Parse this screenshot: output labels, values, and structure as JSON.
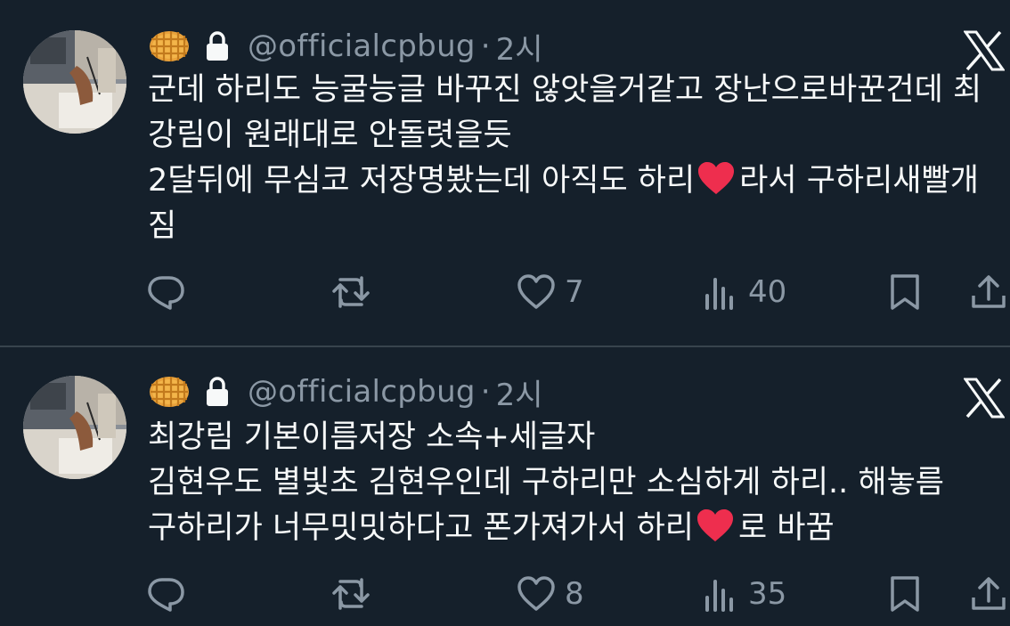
{
  "tweets": [
    {
      "handle": "@officialcpbug",
      "separator": "·",
      "time": "2시",
      "lines": [
        "군데 하리도 능굴능글 바꾸진 않앗을거같고 장난으로바꾼건데 최",
        "강림이 원래대로 안돌렷을듯",
        {
          "before": "2달뒤에 무심코 저장명봤는데 아직도 하리",
          "after": "라서 구하리새빨개"
        },
        "짐"
      ],
      "likes": "7",
      "views": "40"
    },
    {
      "handle": "@officialcpbug",
      "separator": "·",
      "time": "2시",
      "lines": [
        "최강림 기본이름저장 소속+세글자",
        "김현우도 별빛초 김현우인데 구하리만 소심하게 하리.. 해놓름",
        {
          "before": "구하리가 너무밋밋하다고 폰가져가서 하리",
          "after": "로 바꿈"
        }
      ],
      "likes": "8",
      "views": "35"
    }
  ],
  "icons": {
    "emoji_name": "waffle-icon",
    "lock": "lock-icon",
    "brand": "x-logo-icon",
    "heart_emoji": "red-heart-icon",
    "reply": "reply-icon",
    "retweet": "retweet-icon",
    "like": "like-icon",
    "views": "views-icon",
    "bookmark": "bookmark-icon",
    "share": "share-icon"
  },
  "colors": {
    "background": "#15202b",
    "text": "#f7f9f9",
    "muted": "#8b98a5",
    "heart": "#e0245e"
  }
}
